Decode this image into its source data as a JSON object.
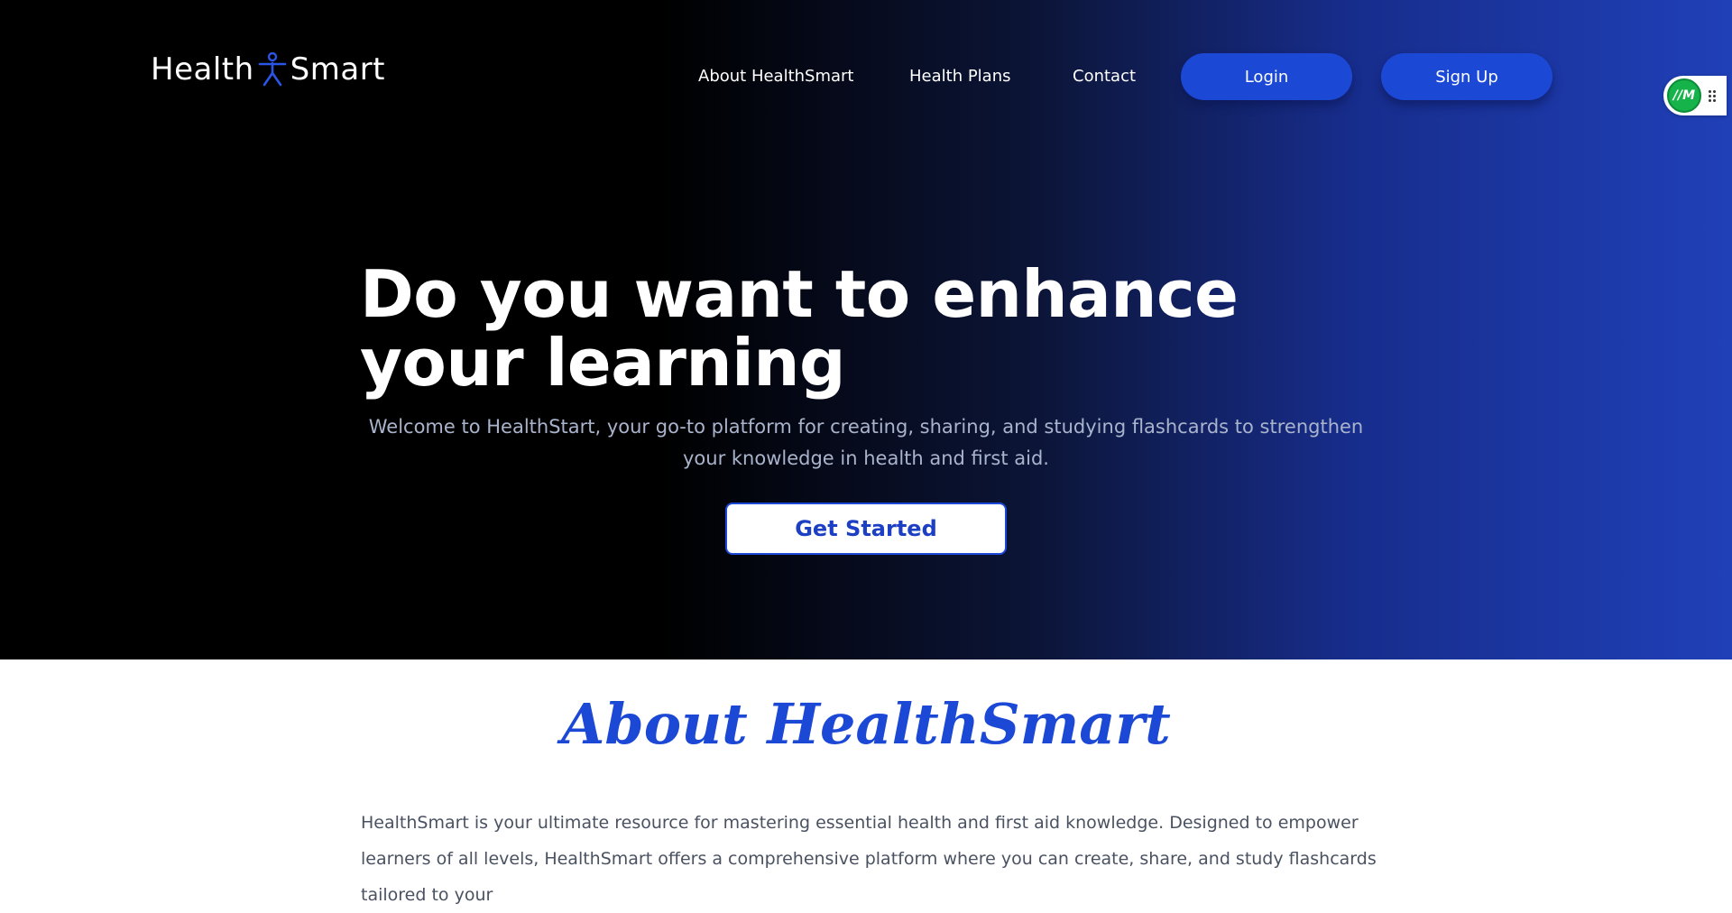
{
  "nav": {
    "logo_left": "Health",
    "logo_right": "Smart",
    "logo_icon": "person-figure-icon",
    "links": {
      "about": "About HealthSmart",
      "plans": "Health Plans",
      "contact": "Contact"
    },
    "login_label": "Login",
    "signup_label": "Sign Up"
  },
  "widget": {
    "badge_text": "//M",
    "icon": "grip-dots-icon"
  },
  "hero": {
    "title": "Do you want to enhance your learning",
    "subtitle": "Welcome to HealthStart, your go-to platform for creating, sharing, and studying flashcards to strengthen your knowledge in health and first aid.",
    "cta_label": "Get Started"
  },
  "about": {
    "heading": "About HealthSmart",
    "text": "HealthSmart is your ultimate resource for mastering essential health and first aid knowledge. Designed to empower learners of all levels, HealthSmart offers a comprehensive platform where you can create, share, and study flashcards tailored to your"
  },
  "colors": {
    "accent": "#1c48d6",
    "hero_dark": "#000000",
    "hero_blue": "#2040b8",
    "subtitle": "#a9b4cc",
    "body_text": "#4a5262"
  }
}
